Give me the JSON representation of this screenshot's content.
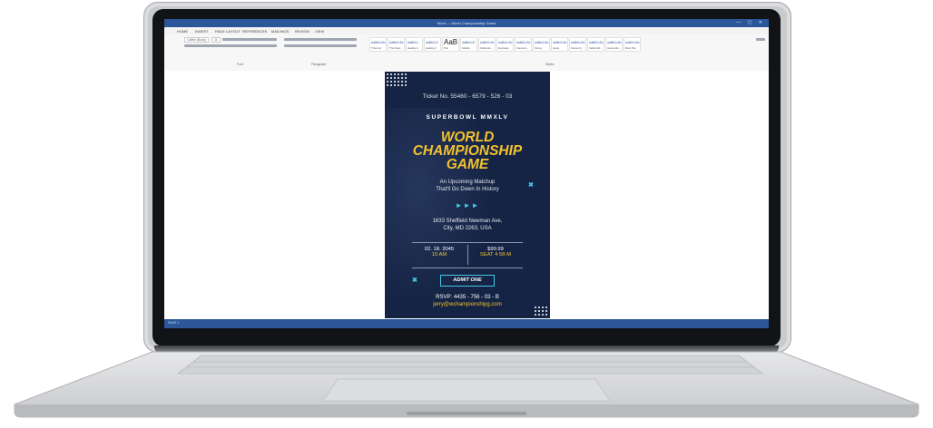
{
  "window": {
    "title": "Word — World Championship Game",
    "tabs": [
      "HOME",
      "INSERT",
      "PAGE LAYOUT",
      "REFERENCES",
      "MAILINGS",
      "REVIEW",
      "VIEW"
    ],
    "window_controls": "—  ▢  ✕"
  },
  "ribbon": {
    "font_name": "Calibri (Body)",
    "font_size": "11",
    "group_labels": [
      "Font",
      "Paragraph",
      "Styles"
    ],
    "styles": [
      {
        "sample": "AaBbCcDc",
        "name": "¶ Normal"
      },
      {
        "sample": "AaBbCcDc",
        "name": "¶ No Spac..."
      },
      {
        "sample": "AaBbCc",
        "name": "Heading 1"
      },
      {
        "sample": "AaBbCcC",
        "name": "Heading 2"
      },
      {
        "sample": "AaB",
        "name": "Title"
      },
      {
        "sample": "AaBbCcD",
        "name": "Subtitle"
      },
      {
        "sample": "AaBbCcDc",
        "name": "Subtle Em..."
      },
      {
        "sample": "AaBbCcDc",
        "name": "Emphasis"
      },
      {
        "sample": "AaBbCcDc",
        "name": "Intense E..."
      },
      {
        "sample": "AaBbCcDc",
        "name": "Strong"
      },
      {
        "sample": "AaBbCcDc",
        "name": "Quote"
      },
      {
        "sample": "AaBbCcDc",
        "name": "Intense Q..."
      },
      {
        "sample": "AaBbCcDc",
        "name": "Subtle Ref..."
      },
      {
        "sample": "AaBbCcDc",
        "name": "Intense Re..."
      },
      {
        "sample": "AaBbCcDc",
        "name": "Book Title"
      }
    ]
  },
  "status_bar": {
    "page_info": "PAGE 1"
  },
  "flyer": {
    "ticket_number": "Ticket No. 55460 - 6579 - 526 - 03",
    "event_series": "SUPERBOWL MMXLV",
    "headline_line1": "WORLD",
    "headline_line2": "CHAMPIONSHIP",
    "headline_line3": "GAME",
    "tagline_line1": "An Upcoming Matchup",
    "tagline_line2": "That'll Go Down In History",
    "arrows": "►►►",
    "address_line1": "1633 Sheffield Newman Ave,",
    "address_line2": "City, MD 2263, USA",
    "date": "02. 18. 2045",
    "time": "10 AM",
    "price": "$99.99",
    "seat": "SEAT 4 58-M",
    "admit": "ADMIT ONE",
    "rsvp": "RSVP: 4435 - 756 - 03 - B",
    "email": "jerry@wchampionshipg.com",
    "colors": {
      "background": "#152444",
      "accent_yellow": "#f2c12e",
      "accent_cyan": "#41c9e8"
    }
  }
}
